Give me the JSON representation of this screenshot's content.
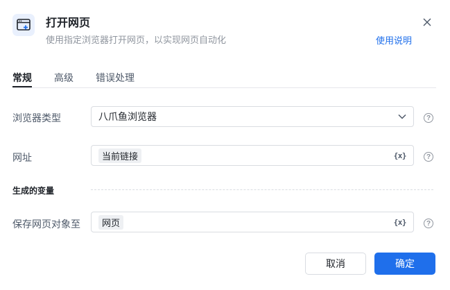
{
  "dialog": {
    "title": "打开网页",
    "subtitle": "使用指定浏览器打开网页，以实现网页自动化",
    "help_link": "使用说明"
  },
  "tabs": [
    {
      "label": "常规",
      "active": true
    },
    {
      "label": "高级",
      "active": false
    },
    {
      "label": "错误处理",
      "active": false
    }
  ],
  "form": {
    "browser_type": {
      "label": "浏览器类型",
      "value": "八爪鱼浏览器"
    },
    "url": {
      "label": "网址",
      "value": "当前链接"
    },
    "variables_section": {
      "title": "生成的变量"
    },
    "save_object": {
      "label": "保存网页对象至",
      "value": "网页"
    }
  },
  "var_icon_text": "{x}",
  "help_icon_text": "?",
  "buttons": {
    "cancel": "取消",
    "ok": "确定"
  },
  "colors": {
    "accent": "#1f6feb",
    "chip_bg": "#eef0f3",
    "icon_bg": "#e9f0fd"
  }
}
